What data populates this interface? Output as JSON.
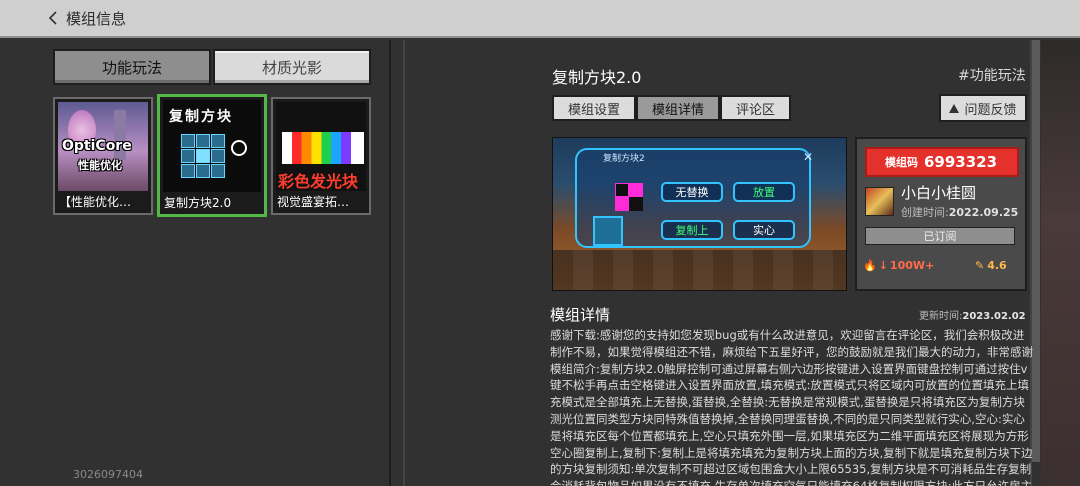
{
  "header": {
    "title": "模组信息"
  },
  "left": {
    "tabs": [
      {
        "label": "功能玩法",
        "active": true
      },
      {
        "label": "材质光影",
        "active": false
      }
    ],
    "cards": [
      {
        "caption": "【性能优化…",
        "thumb_text_1": "OptiCore",
        "thumb_text_2": "性能优化"
      },
      {
        "caption": "复制方块2.0",
        "thumb_text_1": "复制方块",
        "selected": true
      },
      {
        "caption": "视觉盛宴拓…",
        "thumb_text_1": "彩色发光块"
      }
    ],
    "user_id": "3026097404"
  },
  "detail": {
    "title": "复制方块2.0",
    "tag": "#功能玩法",
    "segments": [
      {
        "label": "模组设置",
        "active": false
      },
      {
        "label": "模组详情",
        "active": true
      },
      {
        "label": "评论区",
        "active": false
      }
    ],
    "report_label": "问题反馈",
    "screenshot": {
      "panel_title": "复制方块2",
      "buttons": [
        "无替换",
        "放置",
        "复制上",
        "实心"
      ]
    },
    "info": {
      "code_label": "模组码",
      "code_value": "6993323",
      "author": "小白小桂圆",
      "created_label": "创建时间:",
      "created_value": "2022.09.25",
      "subscribe_label": "已订阅",
      "downloads": "100W+",
      "rating": "4.6"
    },
    "section_title": "模组详情",
    "updated_label": "更新时间:",
    "updated_value": "2023.02.02",
    "description": "感谢下载:感谢您的支持如您发现bug或有什么改进意见，欢迎留言在评论区，我们会积极改进制作不易，如果觉得模组还不错，麻烦给下五星好评，您的鼓励就是我们最大的动力，非常感谢模组简介:复制方块2.0触屏控制可通过屏幕右侧六边形按键进入设置界面键盘控制可通过按住v键不松手再点击空格键进入设置界面放置,填充模式:放置模式只将区域内可放置的位置填充上填充模式是全部填充上无替换,蛋替换,全替换:无替换是常规模式,蛋替换是只将填充区为复制方块测光位置同类型方块同特殊值替换掉,全替换同理蛋替换,不同的是只同类型就行实心,空心:实心是将填充区每个位置都填充上,空心只填充外围一层,如果填充区为二维平面填充区将展现为方形空心圈复制上,复制下:复制上是将填充填充为复制方块上面的方块,复制下就是填充复制方块下边的方块复制须知:单次复制不可超过区域包围盒大小上限65535,复制方块是不可消耗品生存复制会消耗背包物品如果没有不填充,生存单次填充空气只能填充64格复制权限方块:此方只允许房主使用,玩家第一次进入为默认,房主可通过复制权限方块左上角设置默认模式,也可单"
  },
  "colors": {
    "accent_green": "#52b948",
    "code_red": "#e4312b",
    "panel_blue": "#32c4ff"
  }
}
